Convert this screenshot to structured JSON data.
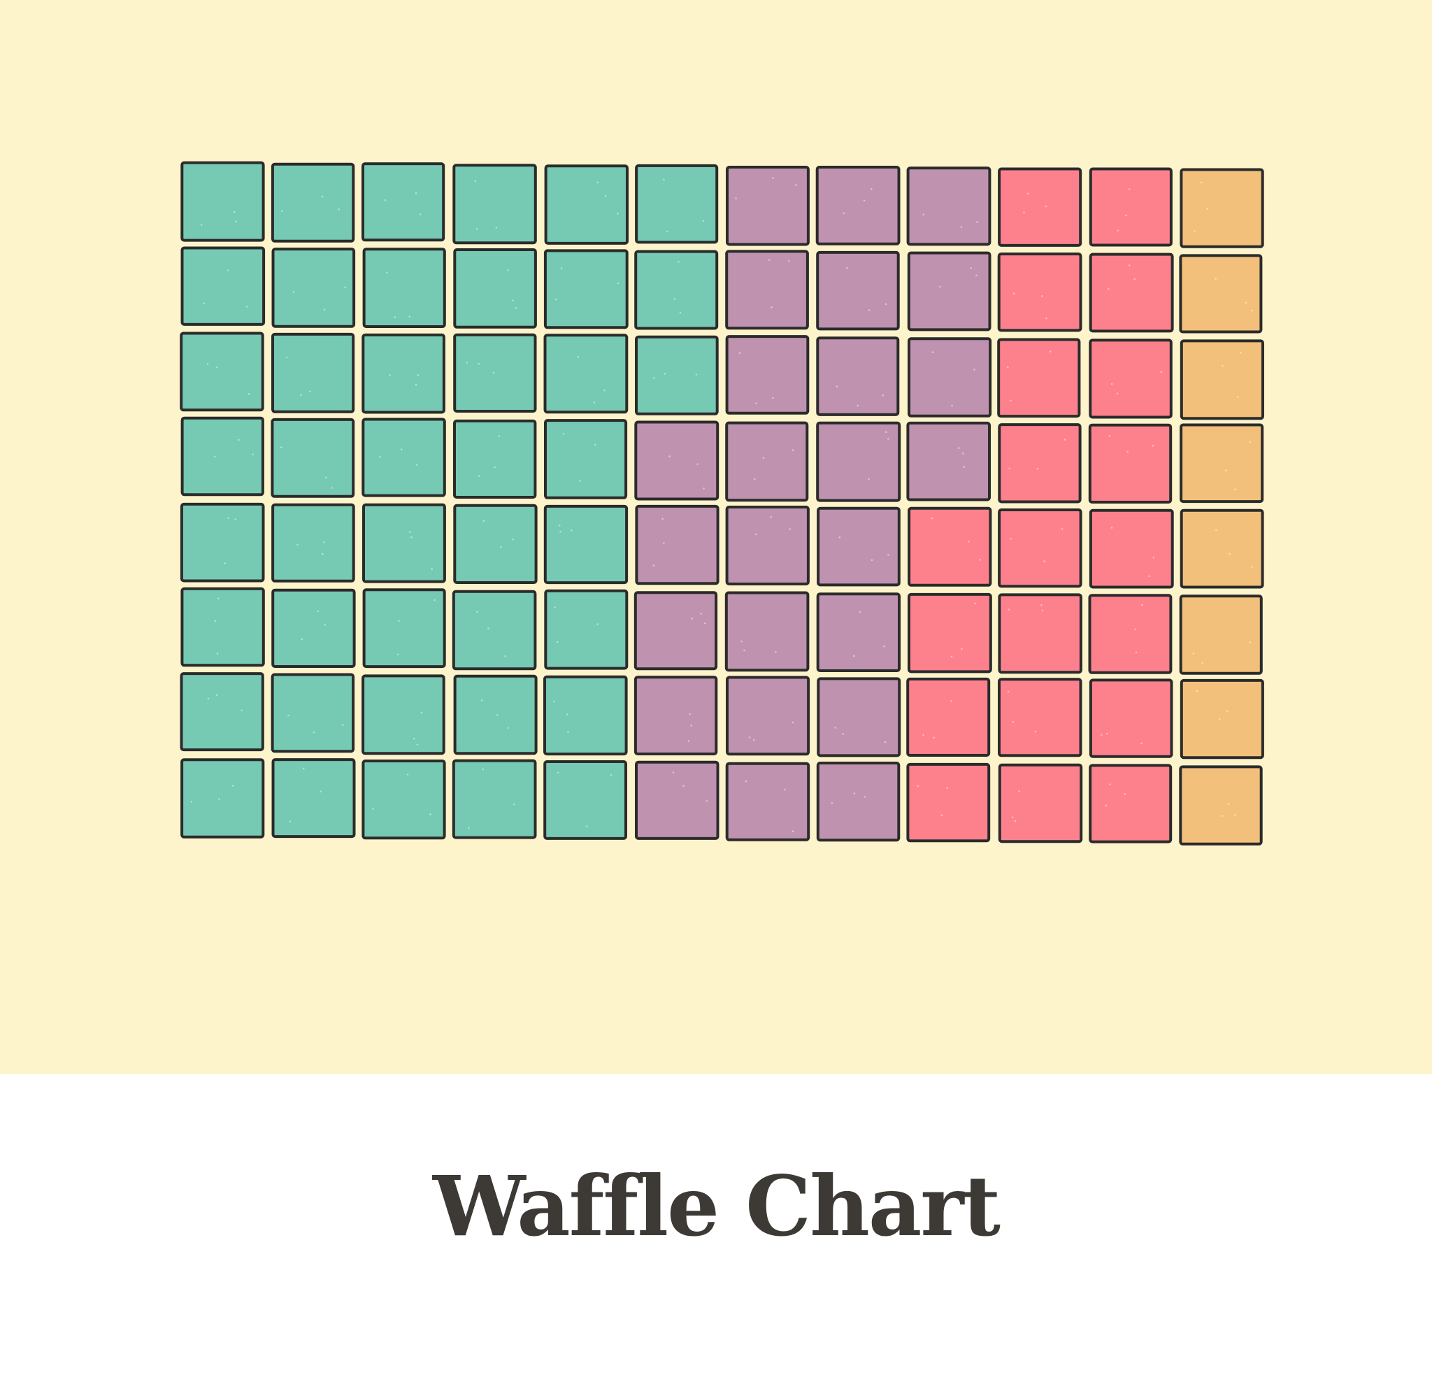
{
  "caption": {
    "title": "Waffle Chart"
  },
  "chart_data": {
    "type": "waffle",
    "title": "",
    "rows": 8,
    "columns": 12,
    "fill_order": "column-major",
    "total_cells": 96,
    "categories": [
      {
        "count": 43,
        "color": "#76c9b2"
      },
      {
        "count": 25,
        "color": "#bf92b0"
      },
      {
        "count": 20,
        "color": "#fd818d"
      },
      {
        "count": 8,
        "color": "#f3c07b"
      }
    ],
    "cell_border_color": "#2b2b2b",
    "background_color": "#fdf4cc",
    "legend": "none",
    "grid": false
  }
}
